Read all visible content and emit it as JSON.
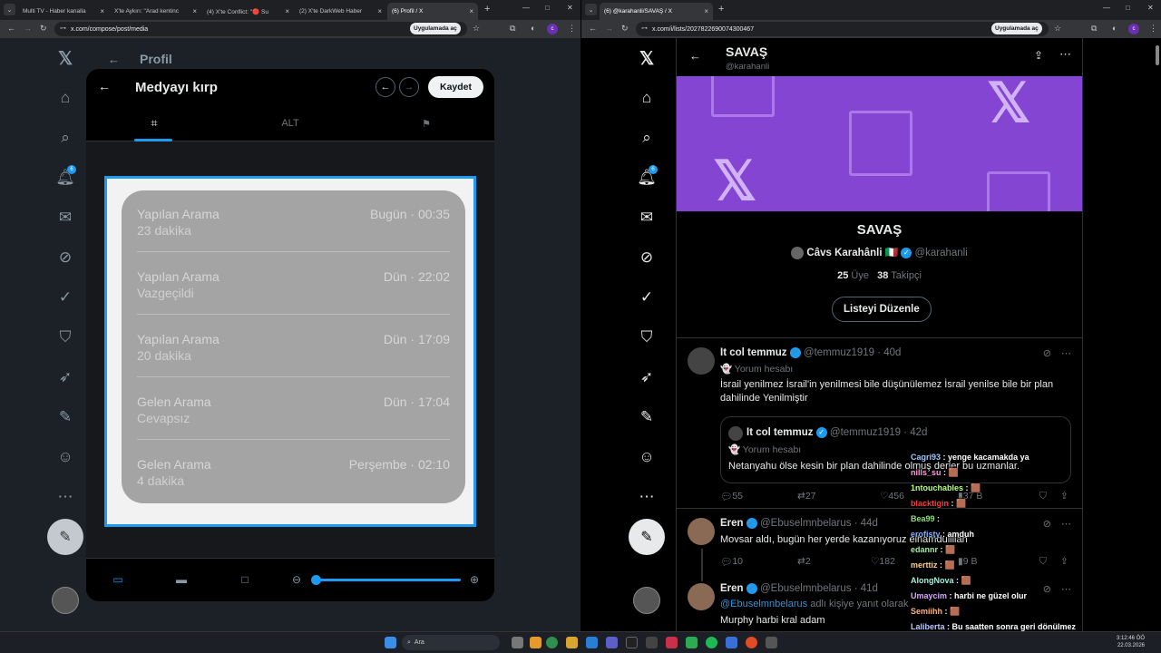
{
  "left_window": {
    "tabs": [
      {
        "title": "Multi TV - Haber kanalla"
      },
      {
        "title": "X'te Aykırı: \"Arad kentinc"
      },
      {
        "title": "(4) X'te Conflict: \"🔴 Su"
      },
      {
        "title": "(2) X'te DarkWeb Haber"
      },
      {
        "title": "(6) Profil / X"
      }
    ],
    "url": "x.com/compose/post/media",
    "app_button": "Uygulamada aç",
    "profile_letter": "c",
    "nav": {
      "badge": "6"
    },
    "page_title": "Profil",
    "modal": {
      "title": "Medyayı kırp",
      "save_label": "Kaydet",
      "tab_alt": "ALT",
      "calls": [
        {
          "type": "Yapılan Arama",
          "detail": "23 dakika",
          "when": "Bugün · 00:35"
        },
        {
          "type": "Yapılan Arama",
          "detail": "Vazgeçildi",
          "when": "Dün · 22:02"
        },
        {
          "type": "Yapılan Arama",
          "detail": "20 dakika",
          "when": "Dün · 17:09"
        },
        {
          "type": "Gelen Arama",
          "detail": "Cevapsız",
          "when": "Dün · 17:04"
        },
        {
          "type": "Gelen Arama",
          "detail": "4 dakika",
          "when": "Perşembe · 02:10"
        }
      ],
      "zoom_fraction": 0
    }
  },
  "right_window": {
    "tabs": [
      {
        "title": "(6) @karahanli/SAVAŞ / X"
      }
    ],
    "url": "x.com/i/lists/2027822690074300467",
    "app_button": "Uygulamada aç",
    "profile_letter": "c",
    "nav": {
      "badge": "6"
    },
    "list": {
      "name": "SAVAŞ",
      "handle": "@karahanli",
      "owner_name": "Câvs Karahânli 🇮🇹",
      "owner_handle": "@karahanli",
      "members_count": "25",
      "members_label": "Üye",
      "followers_count": "38",
      "followers_label": "Takipçi",
      "edit_button": "Listeyi Düzenle"
    },
    "tweets": [
      {
        "name": "It col temmuz",
        "handle": "@temmuz1919 · 40d",
        "sub": "👻 Yorum hesabı",
        "text": "İsrail yenilmez İsrail'in yenilmesi bile düşünülemez İsrail yenilse bile bir plan dahilinde Yenilmiştir",
        "quote": {
          "name": "It col temmuz",
          "handle": "@temmuz1919 · 42d",
          "sub": "👻 Yorum hesabı",
          "text": "Netanyahu ölse kesin bir plan dahilinde olmuş derler bu uzmanlar."
        },
        "replies": "55",
        "retweets": "27",
        "likes": "456",
        "views": "37 B"
      },
      {
        "name": "Eren",
        "handle": "@Ebuselmnbelarus · 44d",
        "text": "Movsar aldı, bugün her yerde kazanıyoruz elhamdulillah",
        "replies": "10",
        "retweets": "2",
        "likes": "182",
        "views": "9 B"
      },
      {
        "name": "Eren",
        "handle": "@Ebuselmnbelarus · 41d",
        "reply_to": "@Ebuselmnbelarus",
        "reply_suffix": " adlı kişiye yanıt olarak",
        "text": "Murphy harbi kral adam"
      }
    ]
  },
  "chat": [
    {
      "user": "Cagri93",
      "msg": "yenge kacamakda ya",
      "color": "#9ec5ff"
    },
    {
      "user": "nills_su",
      "msg": "🟫",
      "color": "#ff9ae0"
    },
    {
      "user": "1ntouchables",
      "msg": "🟫",
      "color": "#b7ff7a"
    },
    {
      "user": "blacktigin",
      "msg": "🟫",
      "color": "#ff3b3b"
    },
    {
      "user": "Bea99",
      "msg": "",
      "color": "#8ee07a"
    },
    {
      "user": "erofisty",
      "msg": "amduh",
      "color": "#7fb0ff"
    },
    {
      "user": "edannr",
      "msg": "🟫",
      "color": "#9ef09e"
    },
    {
      "user": "merttiz",
      "msg": "🟫",
      "color": "#ffd27a"
    },
    {
      "user": "AlongNova",
      "msg": "🟫",
      "color": "#9ef0e0"
    },
    {
      "user": "Umaycim",
      "msg": "harbi ne güzel olur",
      "color": "#d9a6ff"
    },
    {
      "user": "Semiihh",
      "msg": "🟫",
      "color": "#ffb37a"
    },
    {
      "user": "Laliberta",
      "msg": "Bu saatten sonra geri dönülmez",
      "color": "#b8c8ff"
    }
  ],
  "taskbar": {
    "search_placeholder": "Ara",
    "time": "3:12:46 ÖÖ",
    "date": "22.03.2026"
  }
}
